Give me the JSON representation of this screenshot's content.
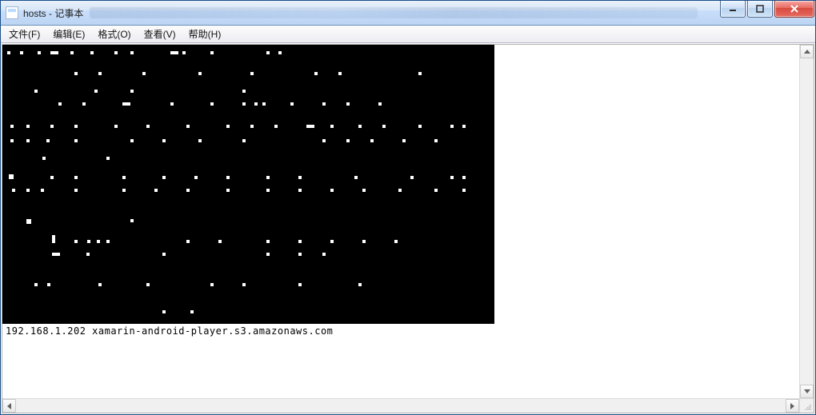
{
  "window": {
    "title": "hosts - 记事本"
  },
  "menu": {
    "file": "文件(F)",
    "edit": "编辑(E)",
    "format": "格式(O)",
    "view": "查看(V)",
    "help": "帮助(H)"
  },
  "editor": {
    "visible_line": "192.168.1.202 xamarin-android-player.s3.amazonaws.com"
  },
  "icons": {
    "minimize": "minimize-icon",
    "maximize": "maximize-icon",
    "close": "close-icon"
  }
}
